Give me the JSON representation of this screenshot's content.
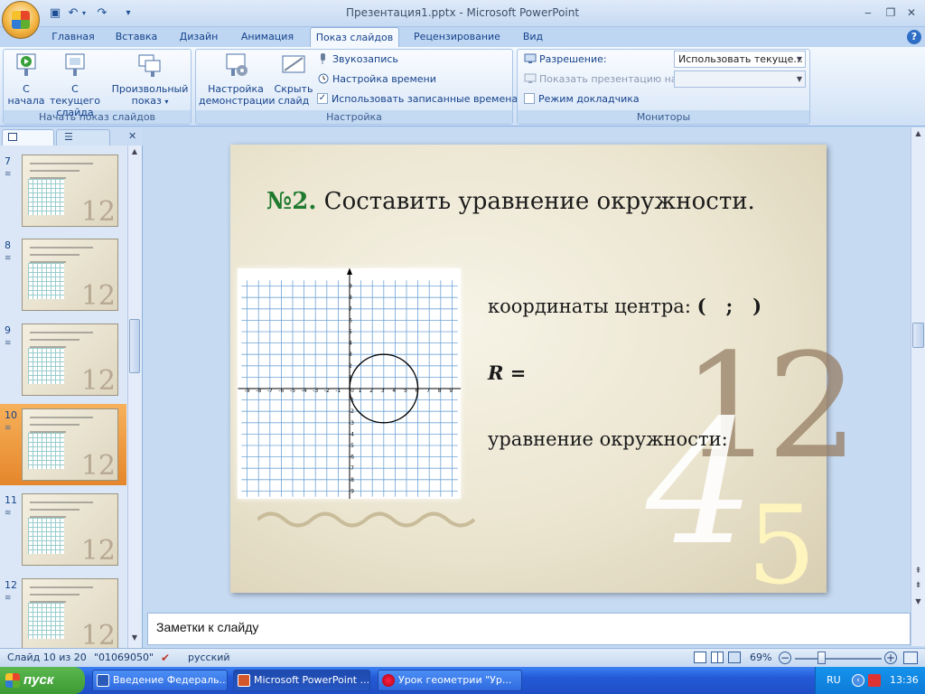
{
  "window": {
    "title": "Презентация1.pptx - Microsoft PowerPoint"
  },
  "tabs": [
    "Главная",
    "Вставка",
    "Дизайн",
    "Анимация",
    "Показ слайдов",
    "Рецензирование",
    "Вид"
  ],
  "ribbon": {
    "start_group": {
      "label": "Начать показ слайдов",
      "from_start_1": "С",
      "from_start_2": "начала",
      "from_current_1": "С текущего",
      "from_current_2": "слайда",
      "custom_1": "Произвольный",
      "custom_2": "показ"
    },
    "setup_group": {
      "label": "Настройка",
      "setup_1": "Настройка",
      "setup_2": "демонстрации",
      "hide_1": "Скрыть",
      "hide_2": "слайд",
      "record_narration": "Звукозапись",
      "rehearse_timings": "Настройка времени",
      "use_timings": "Использовать записанные времена"
    },
    "monitors_group": {
      "label": "Мониторы",
      "resolution_label": "Разрешение:",
      "resolution_value": "Использовать текуще...",
      "show_on_label": "Показать презентацию на:",
      "presenter_view": "Режим докладчика"
    }
  },
  "thumbnails": [
    {
      "num": "7",
      "selected": false
    },
    {
      "num": "8",
      "selected": false
    },
    {
      "num": "9",
      "selected": false
    },
    {
      "num": "10",
      "selected": true
    },
    {
      "num": "11",
      "selected": false
    },
    {
      "num": "12",
      "selected": false
    }
  ],
  "slide": {
    "title_number": "№2.",
    "title_text": "Составить уравнение окружности.",
    "center_label": "координаты центра:",
    "center_value": "(   ;   )",
    "radius_label": "R",
    "radius_eq": "=",
    "equation_label": "уравнение окружности:",
    "deco_12": "12",
    "deco_4": "4",
    "deco_5": "5",
    "grid_x_ticks": [
      "-9",
      "-8",
      "-7",
      "-6",
      "-5",
      "-4",
      "-3",
      "-2",
      "-1",
      "0",
      "1",
      "2",
      "3",
      "4",
      "5",
      "6",
      "7",
      "8",
      "9"
    ],
    "grid_y_ticks": [
      "9",
      "8",
      "7",
      "6",
      "5",
      "4",
      "3",
      "2",
      "1",
      "-1",
      "-2",
      "-3",
      "-4",
      "-5",
      "-6",
      "-7",
      "-8",
      "-9"
    ],
    "circle_center": [
      3,
      0
    ],
    "circle_radius": 3
  },
  "notes": {
    "placeholder": "Заметки к слайду"
  },
  "status": {
    "slide_info": "Слайд 10 из 20",
    "theme": "\"01069050\"",
    "language": "русский",
    "zoom": "69%"
  },
  "taskbar": {
    "start": "пуск",
    "items": [
      "Введение Федераль...",
      "Microsoft PowerPoint ...",
      "Урок геометрии \"Ур..."
    ],
    "lang": "RU",
    "time": "13:36"
  }
}
